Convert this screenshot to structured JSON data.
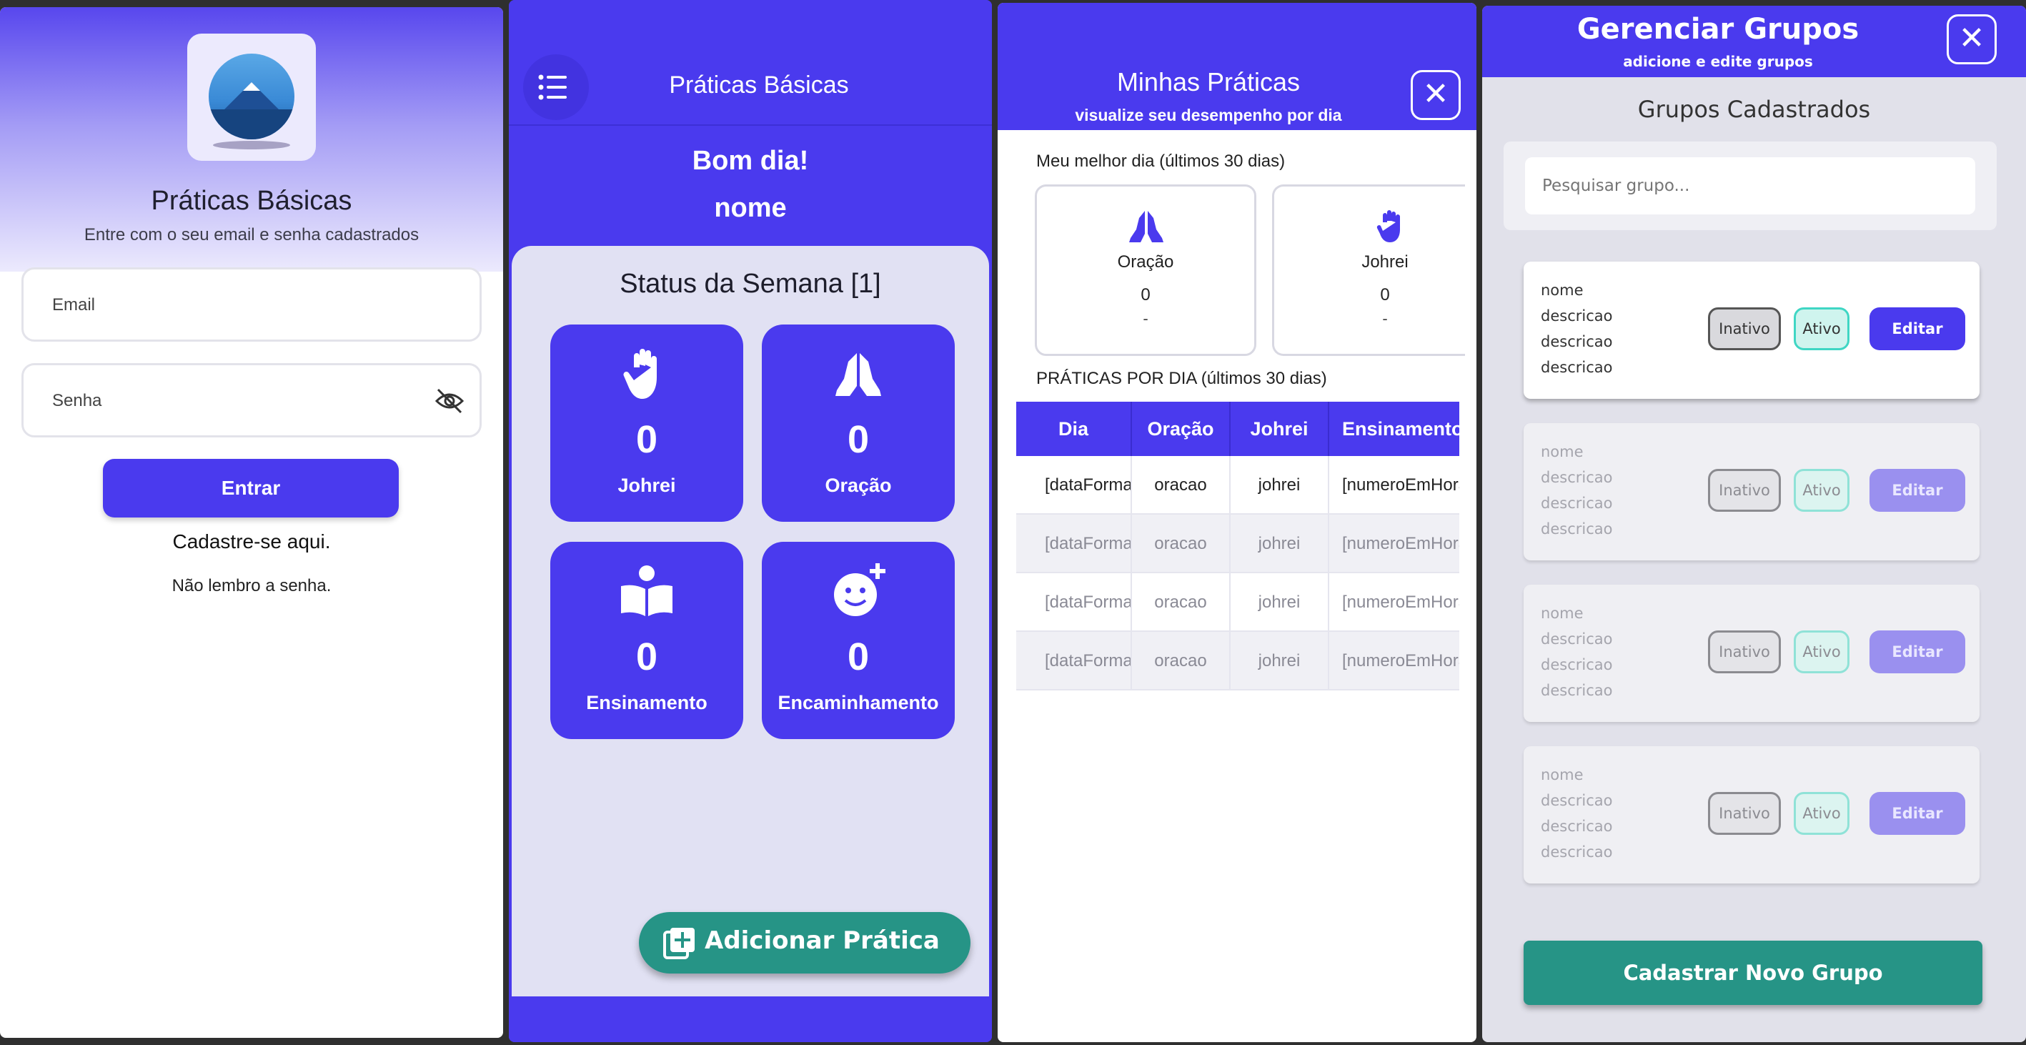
{
  "login": {
    "title": "Práticas Básicas",
    "subtitle": "Entre com o seu email e senha cadastrados",
    "email_placeholder": "Email",
    "password_placeholder": "Senha",
    "submit_label": "Entrar",
    "register_link": "Cadastre-se aqui.",
    "forgot_link": "Não lembro a senha.",
    "password_toggle_icon": "eye-off-icon"
  },
  "home": {
    "title": "Práticas Básicas",
    "menu_icon": "list-menu-icon",
    "greeting": "Bom dia!",
    "user_name": "nome",
    "week_status": "Status da Semana [1]",
    "tiles": [
      {
        "label": "Johrei",
        "value": "0",
        "icon": "raised-hand-icon"
      },
      {
        "label": "Oração",
        "value": "0",
        "icon": "praying-hands-icon"
      },
      {
        "label": "Ensinamento",
        "value": "0",
        "icon": "reading-person-icon"
      },
      {
        "label": "Encaminhamento",
        "value": "0",
        "icon": "add-reaction-icon"
      }
    ],
    "fab_label": "Adicionar Prática",
    "fab_icon": "add-box-icon"
  },
  "minhas_praticas": {
    "title": "Minhas Práticas",
    "subtitle": "visualize seu desempenho por dia",
    "close": "✕",
    "best_day_label": "Meu melhor dia (últimos 30 dias)",
    "best_cards": [
      {
        "name": "Oração",
        "value": "0",
        "extra": "-",
        "icon": "praying-hands-icon"
      },
      {
        "name": "Johrei",
        "value": "0",
        "extra": "-",
        "icon": "raised-hand-icon"
      }
    ],
    "per_day_label": "PRÁTICAS POR DIA  (últimos 30 dias)",
    "columns": [
      "Dia",
      "Oração",
      "Johrei",
      "Ensinamento"
    ],
    "rows": [
      [
        "[dataFormatada]",
        "oracao",
        "johrei",
        "[numeroEmHora]"
      ],
      [
        "[dataFormatada]",
        "oracao",
        "johrei",
        "[numeroEmHora]"
      ],
      [
        "[dataFormatada]",
        "oracao",
        "johrei",
        "[numeroEmHora]"
      ],
      [
        "[dataFormatada]",
        "oracao",
        "johrei",
        "[numeroEmHora]"
      ]
    ]
  },
  "grupos": {
    "title": "Gerenciar Grupos",
    "subtitle": "adicione e edite grupos",
    "close": "✕",
    "section_title": "Grupos Cadastrados",
    "search_placeholder": "Pesquisar grupo...",
    "cards": [
      {
        "name": "nome",
        "desc": [
          "descricao",
          "descricao",
          "descricao"
        ],
        "inactive_label": "Inativo",
        "active_label": "Ativo",
        "edit_label": "Editar"
      },
      {
        "name": "nome",
        "desc": [
          "descricao",
          "descricao",
          "descricao"
        ],
        "inactive_label": "Inativo",
        "active_label": "Ativo",
        "edit_label": "Editar"
      },
      {
        "name": "nome",
        "desc": [
          "descricao",
          "descricao",
          "descricao"
        ],
        "inactive_label": "Inativo",
        "active_label": "Ativo",
        "edit_label": "Editar"
      },
      {
        "name": "nome",
        "desc": [
          "descricao",
          "descricao",
          "descricao"
        ],
        "inactive_label": "Inativo",
        "active_label": "Ativo",
        "edit_label": "Editar"
      }
    ],
    "register_button": "Cadastrar Novo Grupo"
  },
  "colors": {
    "primary": "#4a3aee",
    "teal": "#269486",
    "panel": "#e1e1f3"
  }
}
